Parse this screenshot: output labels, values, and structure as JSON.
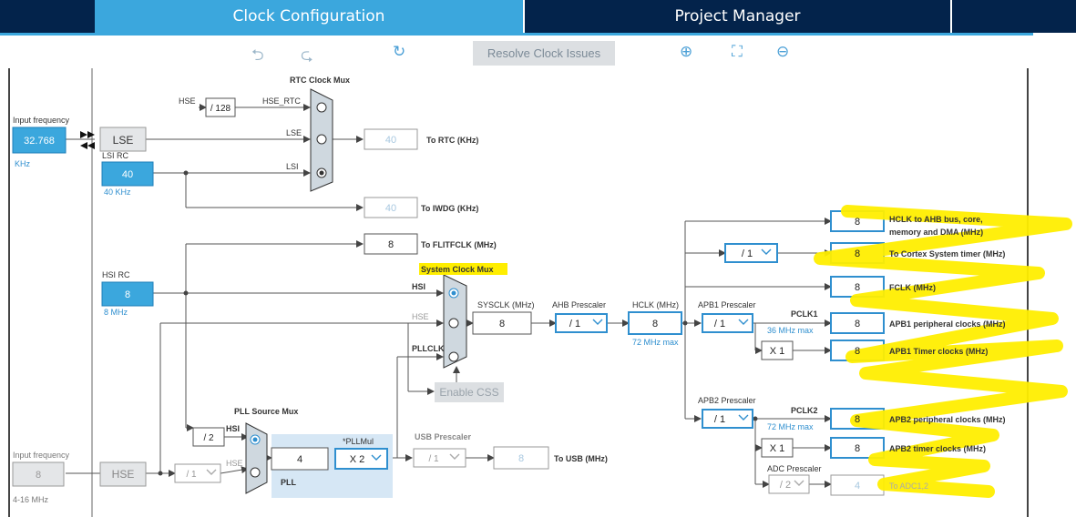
{
  "tabs": [
    {
      "label": "Clock Configuration"
    },
    {
      "label": "Project Manager"
    }
  ],
  "toolbar": {
    "resolve_label": "Resolve Clock Issues"
  },
  "left": {
    "input_freq_label": "Input frequency",
    "lse_value": "32.768",
    "lse_unit": "KHz",
    "lse_name": "LSE",
    "lsi_title": "LSI RC",
    "lsi_value": "40",
    "lsi_sub": "40 KHz",
    "hsi_title": "HSI RC",
    "hsi_value": "8",
    "hsi_sub": "8 MHz",
    "hse_input_label": "Input frequency",
    "hse_value": "8",
    "hse_range": "4-16 MHz",
    "hse_name": "HSE"
  },
  "rtc": {
    "mux_title": "RTC Clock Mux",
    "hse_label": "HSE",
    "div_label": "/ 128",
    "hse_rtc_label": "HSE_RTC",
    "lse_label": "LSE",
    "lsi_label": "LSI",
    "rtc_value": "40",
    "rtc_label": "To RTC (KHz)",
    "iwdg_value": "40",
    "iwdg_label": "To IWDG (KHz)",
    "flit_value": "8",
    "flit_label": "To FLITFCLK (MHz)"
  },
  "sysmux": {
    "title": "System Clock Mux",
    "hsi": "HSI",
    "hse": "HSE",
    "pllclk": "PLLCLK",
    "sysclk_label": "SYSCLK (MHz)",
    "sysclk_value": "8",
    "enable_css": "Enable CSS"
  },
  "ahb": {
    "label": "AHB Prescaler",
    "value": "/ 1"
  },
  "hclk": {
    "label": "HCLK (MHz)",
    "value": "8",
    "max": "72 MHz max"
  },
  "apb1": {
    "label": "APB1 Prescaler",
    "value": "/ 1",
    "pclk": "PCLK1",
    "max": "36 MHz max",
    "timer_mul": "X 1"
  },
  "apb2": {
    "label": "APB2 Prescaler",
    "value": "/ 1",
    "pclk": "PCLK2",
    "max": "72 MHz max",
    "timer_mul": "X 1"
  },
  "adc": {
    "label": "ADC Prescaler",
    "value": "/ 2",
    "out": "4",
    "out_label": "To ADC1,2"
  },
  "cortex_div": "/ 1",
  "outputs": [
    {
      "value": "8",
      "label": "HCLK to AHB bus, core,",
      "label2": "memory and DMA (MHz)"
    },
    {
      "value": "8",
      "label": "To Cortex System timer (MHz)"
    },
    {
      "value": "8",
      "label": "FCLK (MHz)"
    },
    {
      "value": "8",
      "label": "APB1 peripheral clocks (MHz)"
    },
    {
      "value": "8",
      "label": "APB1 Timer clocks (MHz)"
    },
    {
      "value": "8",
      "label": "APB2 peripheral clocks (MHz)"
    },
    {
      "value": "8",
      "label": "APB2 timer clocks (MHz)"
    }
  ],
  "pll": {
    "src_title": "PLL Source Mux",
    "div2": "/ 2",
    "hsi": "HSI",
    "hse": "HSE",
    "pll_value": "4",
    "mul_title": "*PLLMul",
    "mul_value": "X 2",
    "name": "PLL",
    "hse_div": "/ 1"
  },
  "usb": {
    "label": "USB Prescaler",
    "div": "/ 1",
    "value": "8",
    "out_label": "To USB (MHz)"
  },
  "colors": {
    "nav": "#03234b",
    "accent": "#3ba7dd",
    "highlight": "#ffee00"
  }
}
